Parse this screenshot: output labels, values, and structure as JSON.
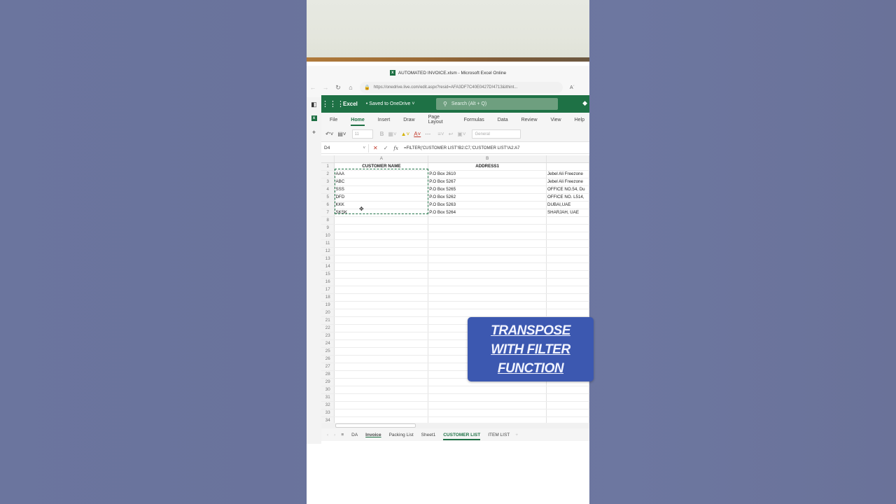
{
  "window": {
    "title": "AUTOMATED INVOICE.xlsm - Microsoft Excel Online"
  },
  "browser": {
    "url": "https://onedrive.live.com/edit.aspx?resid=AFA3DF7C40E0427D!4713&ithint...",
    "reader_label": "Aʿ"
  },
  "app": {
    "name": "Excel",
    "saved_status": "• Saved to OneDrive ˅",
    "search_placeholder": "Search (Alt + Q)"
  },
  "menu": [
    "File",
    "Home",
    "Insert",
    "Draw",
    "Page Layout",
    "Formulas",
    "Data",
    "Review",
    "View",
    "Help"
  ],
  "ribbon": {
    "font_size": "11",
    "number_format": "General"
  },
  "formula_bar": {
    "cell_ref": "D4",
    "formula": "=FILTER('CUSTOMER LIST'!B2:C7,'CUSTOMER LIST'!A2:A7"
  },
  "grid": {
    "columns": [
      "A",
      "B",
      ""
    ],
    "header_row": [
      "CUSTOMER NAME",
      "ADDRESS1",
      ""
    ],
    "rows": [
      [
        "AAA",
        "P.O Box 2610",
        "Jebel Ali Freezone"
      ],
      [
        "ABC",
        "P.O Box 5267",
        "Jebel Ali Freezone"
      ],
      [
        "SSS",
        "P.O Box 5265",
        "OFFICE NO.54, Du"
      ],
      [
        "DFD",
        "P.O Box 5262",
        "OFFICE NO. L514,"
      ],
      [
        "KKK",
        "P.O Box 5263",
        "DUBAI,UAE"
      ],
      [
        "SKSK",
        "P.O Box 5264",
        "SHARJAH, UAE"
      ]
    ],
    "row_count": 34
  },
  "sheets": [
    "DA",
    "Invoice",
    "Packing List",
    "Sheet1",
    "CUSTOMER LIST",
    "ITEM LIST"
  ],
  "active_sheet": "CUSTOMER LIST",
  "banner": {
    "line1": "TRANSPOSE",
    "line2": "WITH FILTER",
    "line3": "FUNCTION"
  },
  "colors": {
    "excel_green": "#1e7145",
    "banner_blue": "#3c58b0",
    "background": "#6b759e"
  }
}
